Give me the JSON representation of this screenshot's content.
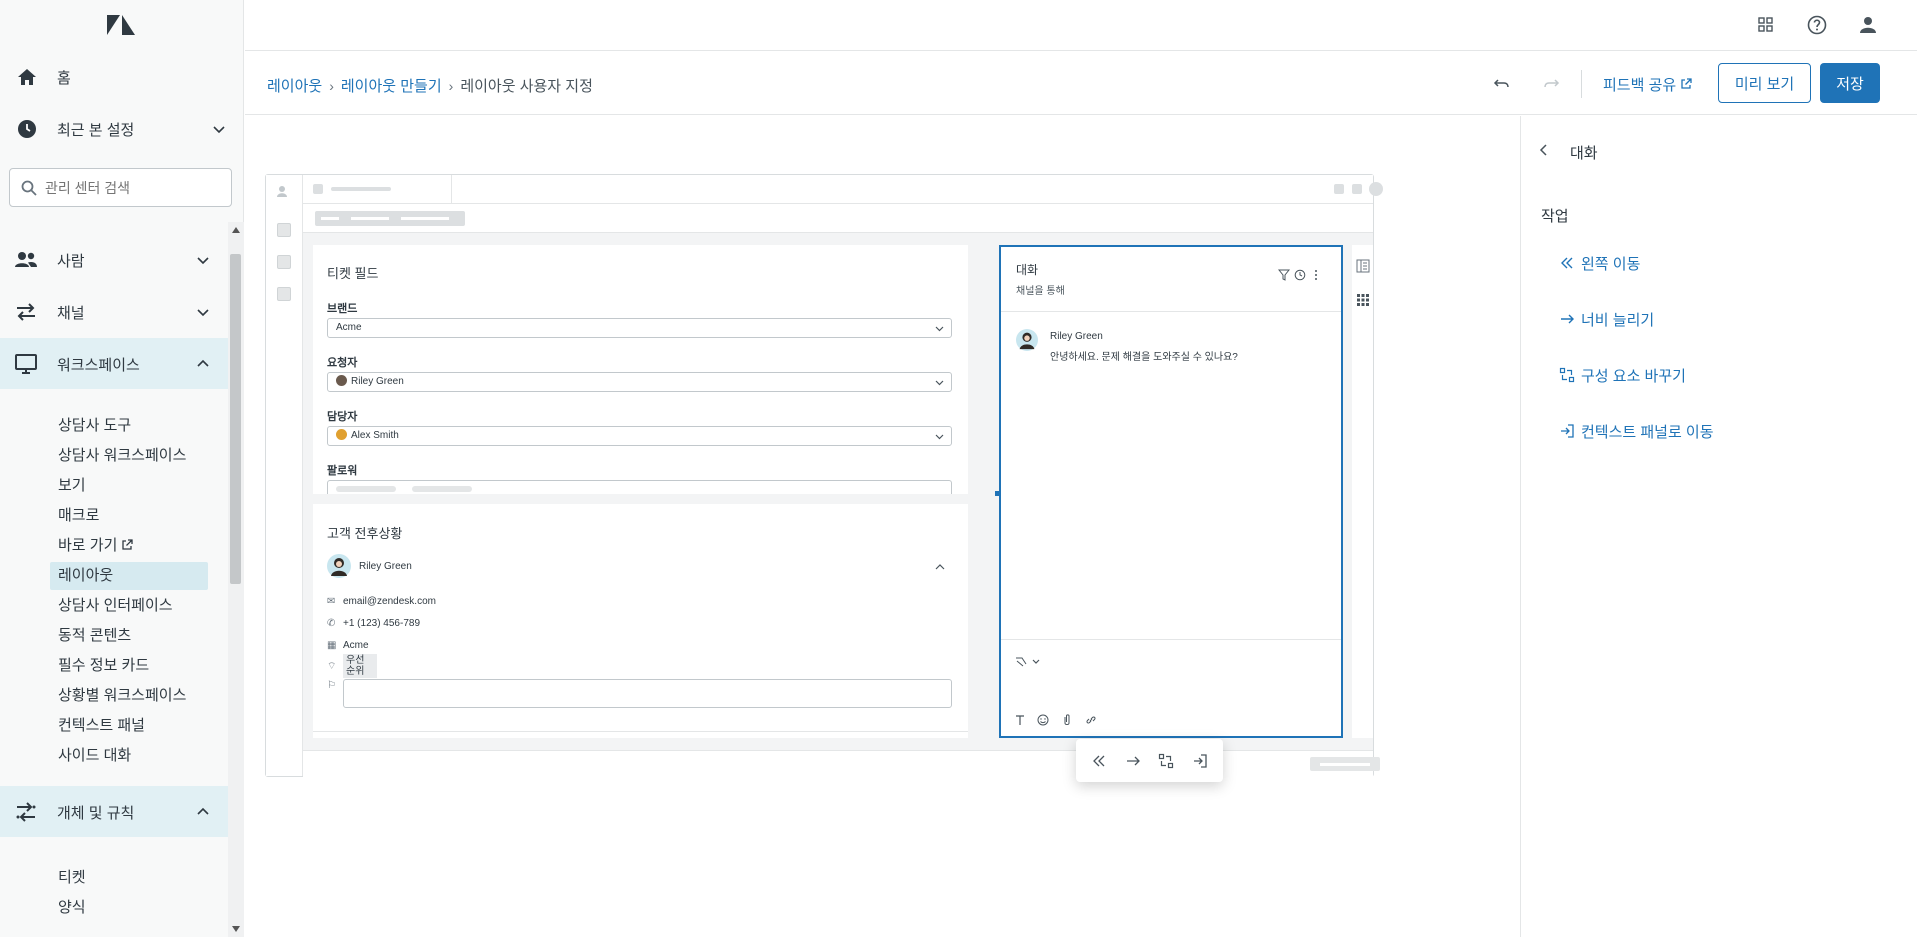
{
  "sidebar": {
    "home_label": "홈",
    "recent_label": "최근 본 설정",
    "search_placeholder": "관리 센터 검색",
    "sections": {
      "people": "사람",
      "channels": "채널",
      "workspaces": "워크스페이스",
      "objects": "개체 및 규칙"
    },
    "workspace_items": [
      "상담사 도구",
      "상담사 워크스페이스",
      "보기",
      "매크로",
      "바로 가기",
      "레이아웃",
      "상담사 인터페이스",
      "동적 콘텐츠",
      "필수 정보 카드",
      "상황별 워크스페이스",
      "컨텍스트 패널",
      "사이드 대화"
    ],
    "object_items": [
      "티켓",
      "양식"
    ]
  },
  "breadcrumb": {
    "crumb1": "레이아웃",
    "crumb2": "레이아웃 만들기",
    "current": "레이아웃 사용자 지정"
  },
  "header": {
    "feedback": "피드백 공유",
    "preview": "미리 보기",
    "save": "저장"
  },
  "mock": {
    "ticket_fields_title": "티켓 필드",
    "brand_label": "브랜드",
    "brand_value": "Acme",
    "requester_label": "요청자",
    "requester_value": "Riley Green",
    "assignee_label": "담당자",
    "assignee_value": "Alex Smith",
    "followers_label": "팔로워",
    "context_title": "고객 전후상황",
    "customer_name": "Riley Green",
    "email": "email@zendesk.com",
    "phone": "+1 (123) 456-789",
    "org": "Acme",
    "priority_tag": "우선 순위",
    "conv_title": "대화",
    "conv_subtitle": "채널을 통해",
    "msg_author": "Riley Green",
    "msg_text": "안녕하세요. 문제 해결을 도와주실 수 있나요?"
  },
  "right_panel": {
    "title": "대화",
    "section": "작업",
    "actions": [
      "왼쪽 이동",
      "너비 늘리기",
      "구성 요소 바꾸기",
      "컨텍스트 패널로 이동"
    ]
  },
  "colors": {
    "accent": "#1f73b7",
    "sidebar_active": "#e1f0f4",
    "text": "#2f3941"
  }
}
